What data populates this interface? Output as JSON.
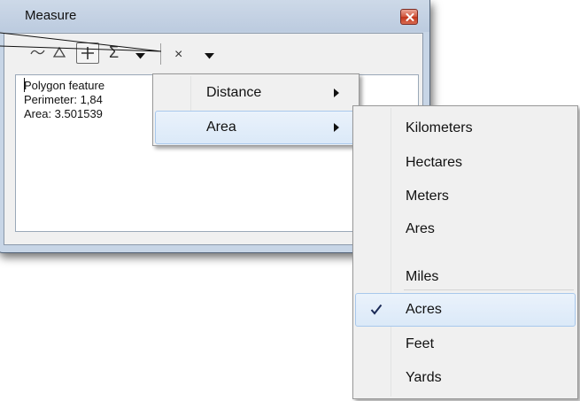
{
  "window": {
    "title": "Measure"
  },
  "toolbar": {
    "tools": [
      "line-icon",
      "polygon-icon",
      "feature-icon"
    ],
    "sum_symbol": "Σ",
    "clear_symbol": "×"
  },
  "results": {
    "lines": [
      "Polygon feature",
      "Perimeter: 1,84",
      "Area: 3.501539"
    ]
  },
  "measure_menu": {
    "items": [
      {
        "label": "Distance",
        "highlighted": false
      },
      {
        "label": "Area",
        "highlighted": true
      }
    ]
  },
  "area_units_menu": {
    "items": [
      {
        "label": "Kilometers",
        "checked": false
      },
      {
        "label": "Hectares",
        "checked": false
      },
      {
        "label": "Meters",
        "checked": false
      },
      {
        "label": "Ares",
        "checked": false
      },
      {
        "label": "Miles",
        "checked": false
      },
      {
        "label": "Acres",
        "checked": true
      },
      {
        "label": "Feet",
        "checked": false
      },
      {
        "label": "Yards",
        "checked": false
      }
    ],
    "check_symbol": "✓"
  },
  "colors": {
    "frame": "#c7d5e6",
    "close_button": "#c2351b",
    "menu_background": "#f0f0f0",
    "highlight": "#dbe9f8"
  }
}
